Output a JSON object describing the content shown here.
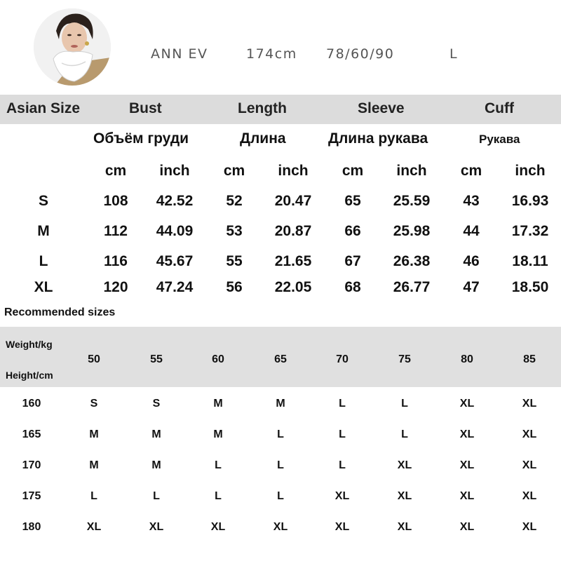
{
  "model": {
    "name": "ANN EV",
    "height": "174cm",
    "measurements": "78/60/90",
    "size": "L"
  },
  "size_chart": {
    "headers": [
      "Asian Size",
      "Bust",
      "Length",
      "Sleeve",
      "Cuff"
    ],
    "russian": [
      "Объём груди",
      "Длина",
      "Длина рукава",
      "Рукава"
    ],
    "units": [
      "cm",
      "inch",
      "cm",
      "inch",
      "cm",
      "inch",
      "cm",
      "inch"
    ],
    "rows": [
      {
        "size": "S",
        "values": [
          "108",
          "42.52",
          "52",
          "20.47",
          "65",
          "25.59",
          "43",
          "16.93"
        ]
      },
      {
        "size": "M",
        "values": [
          "112",
          "44.09",
          "53",
          "20.87",
          "66",
          "25.98",
          "44",
          "17.32"
        ]
      },
      {
        "size": "L",
        "values": [
          "116",
          "45.67",
          "55",
          "21.65",
          "67",
          "26.38",
          "46",
          "18.11"
        ]
      },
      {
        "size": "XL",
        "values": [
          "120",
          "47.24",
          "56",
          "22.05",
          "68",
          "26.77",
          "47",
          "18.50"
        ]
      }
    ]
  },
  "recommended": {
    "title": "Recommended sizes",
    "weight_label": "Weight/kg",
    "height_label": "Height/cm",
    "weights": [
      "50",
      "55",
      "60",
      "65",
      "70",
      "75",
      "80",
      "85"
    ],
    "rows": [
      {
        "height": "160",
        "sizes": [
          "S",
          "S",
          "M",
          "M",
          "L",
          "L",
          "XL",
          "XL"
        ]
      },
      {
        "height": "165",
        "sizes": [
          "M",
          "M",
          "M",
          "L",
          "L",
          "L",
          "XL",
          "XL"
        ]
      },
      {
        "height": "170",
        "sizes": [
          "M",
          "M",
          "L",
          "L",
          "L",
          "XL",
          "XL",
          "XL"
        ]
      },
      {
        "height": "175",
        "sizes": [
          "L",
          "L",
          "L",
          "L",
          "XL",
          "XL",
          "XL",
          "XL"
        ]
      },
      {
        "height": "180",
        "sizes": [
          "XL",
          "XL",
          "XL",
          "XL",
          "XL",
          "XL",
          "XL",
          "XL"
        ]
      }
    ]
  }
}
